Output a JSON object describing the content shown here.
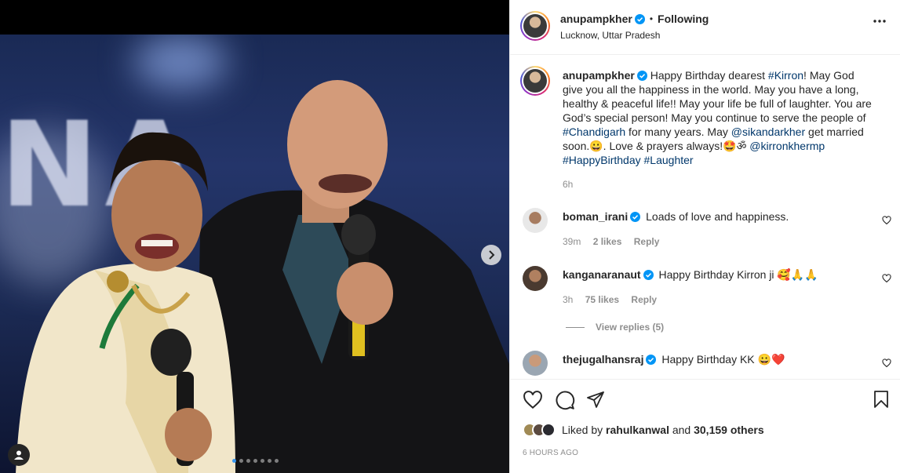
{
  "header": {
    "username": "anupampkher",
    "separator": "•",
    "follow_state": "Following",
    "location": "Lucknow, Uttar Pradesh"
  },
  "caption": {
    "username": "anupampkher",
    "parts": [
      {
        "t": "Happy Birthday dearest ",
        "link": false
      },
      {
        "t": "#Kirron",
        "link": true
      },
      {
        "t": "! May God give you all the happiness in the world. May you have a long, healthy & peaceful life!! May your life be full of laughter. You are God’s special person! May you continue to serve the people of ",
        "link": false
      },
      {
        "t": "#Chandigarh",
        "link": true
      },
      {
        "t": " for many years. May ",
        "link": false
      },
      {
        "t": "@sikandarkher",
        "link": true
      },
      {
        "t": " get married soon.😀. Love & prayers always!🤩ॐ ",
        "link": false
      },
      {
        "t": "@kirronkhermp",
        "link": true
      },
      {
        "t": " ",
        "link": false
      },
      {
        "t": "#HappyBirthday",
        "link": true
      },
      {
        "t": " ",
        "link": false
      },
      {
        "t": "#Laughter",
        "link": true
      }
    ],
    "time": "6h"
  },
  "comments": [
    {
      "username": "boman_irani",
      "text": "Loads of love and happiness.",
      "time": "39m",
      "likes": "2 likes",
      "reply": "Reply"
    },
    {
      "username": "kanganaranaut",
      "text": "Happy Birthday Kirron ji 🥰🙏🙏",
      "time": "3h",
      "likes": "75 likes",
      "reply": "Reply"
    },
    {
      "username": "thejugalhansraj",
      "text": "Happy Birthday KK 😀❤️"
    }
  ],
  "view_replies": "View replies (5)",
  "likes": {
    "prefix": "Liked by",
    "user": "rahulkanwal",
    "and": "and",
    "others": "30,159 others"
  },
  "timestamp": "6 HOURS AGO",
  "carousel": {
    "total": 7,
    "active": 0
  },
  "colors": {
    "link": "#00376b",
    "verified": "#0095f6",
    "active_dot": "#3897f0"
  },
  "icons": [
    "verified-icon",
    "more-icon",
    "heart-icon",
    "comment-icon",
    "share-icon",
    "save-icon",
    "chevron-right-icon",
    "user-tag-icon"
  ]
}
